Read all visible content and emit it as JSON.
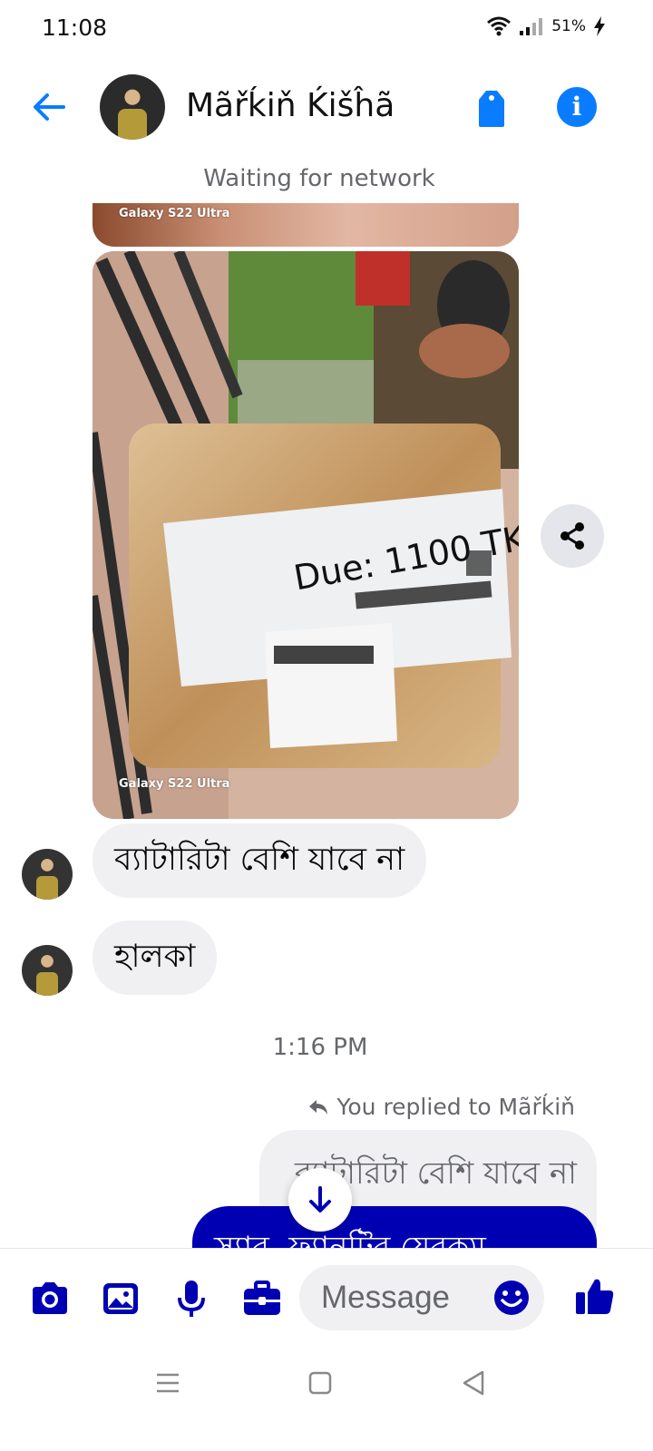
{
  "status_bar": {
    "time": "11:08",
    "battery": "51%"
  },
  "header": {
    "contact_name": "Mãřḱiň Ḱišĥã"
  },
  "banner": {
    "network_status": "Waiting for network"
  },
  "photos": {
    "watermark_top": "Galaxy S22 Ultra",
    "watermark_main": "Galaxy S22 Ultra",
    "label_text": "Due: 1100 TK"
  },
  "messages": [
    {
      "text": "ব্যাটারিটা বেশি যাবে না"
    },
    {
      "text": "হালকা"
    }
  ],
  "timestamp": "1:16 PM",
  "reply": {
    "replied_label": "You replied to Mãřḱiň",
    "quoted_text": "ব্যাটারিটা বেশি যাবে না",
    "outgoing_text": "স্যার, ফ্যানটির যেরকম"
  },
  "composer": {
    "placeholder": "Message"
  },
  "colors": {
    "accent": "#0a7cff",
    "outgoing_bubble": "#0000b3",
    "incoming_bubble": "#f0f0f3"
  }
}
